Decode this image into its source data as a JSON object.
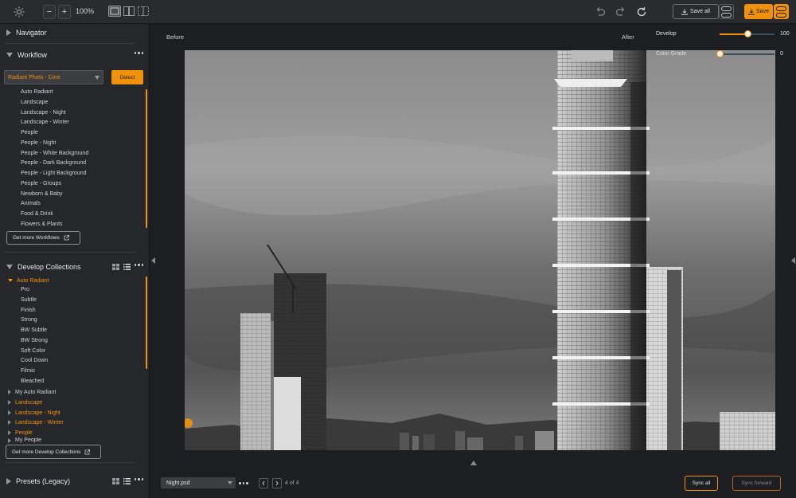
{
  "toolbar": {
    "zoom_out_label": "−",
    "zoom_in_label": "+",
    "zoom_level": "100%",
    "save_all_label": "Save all",
    "save_label": "Save"
  },
  "sidebar": {
    "navigator": {
      "title": "Navigator"
    },
    "workflow": {
      "title": "Workflow",
      "selected": "Radiant Photo - Core",
      "detect_label": "Detect",
      "items": [
        "Auto Radiant",
        "Landscape",
        "Landscape - Night",
        "Landscape - Winter",
        "People",
        "People - Night",
        "People - White Background",
        "People - Dark Background",
        "People - Light Background",
        "People - Groups",
        "Newborn & Baby",
        "Animals",
        "Food & Drink",
        "Flowers & Plants"
      ],
      "get_more_label": "Get more Workflows"
    },
    "develop": {
      "title": "Develop Collections",
      "expanded_group": "Auto Radiant",
      "items": [
        "Pro",
        "Subtle",
        "Finish",
        "Strong",
        "BW Subtle",
        "BW Strong",
        "Soft Color",
        "Cool Down",
        "Filmic",
        "Bleached"
      ],
      "groups": [
        {
          "label": "My Auto Radiant",
          "highlight": false
        },
        {
          "label": "Landscape",
          "highlight": true
        },
        {
          "label": "Landscape - Night",
          "highlight": true
        },
        {
          "label": "Landscape - Winter",
          "highlight": true
        },
        {
          "label": "People",
          "highlight": true
        },
        {
          "label": "My People",
          "highlight": false
        }
      ],
      "get_more_label": "Get more Develop Collections"
    },
    "presets": {
      "title": "Presets (Legacy)"
    }
  },
  "main": {
    "before_label": "Before",
    "after_label": "After",
    "sliders": [
      {
        "label": "Develop",
        "value": "100",
        "fraction": 0.5
      },
      {
        "label": "Color Grade",
        "value": "0",
        "fraction": 0.0
      }
    ]
  },
  "bottom": {
    "file_name": "Night.psd",
    "page_count": "4 of 4",
    "sync_all_label": "Sync all",
    "sync_forward_label": "Sync forward"
  },
  "colors": {
    "accent": "#f0910c",
    "background": "#1e1f22",
    "panel": "#26272a"
  }
}
